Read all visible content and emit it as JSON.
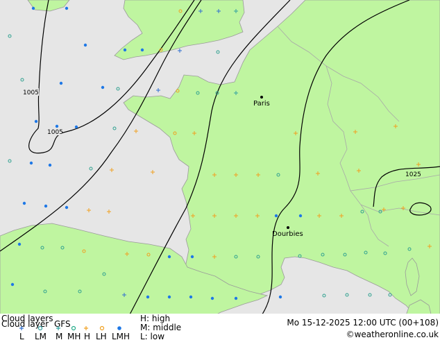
{
  "panel_title": "Cloud layers",
  "panel_subtitle": "Cloud layer",
  "model": "GFS",
  "legend_symbols": [
    {
      "key": "L",
      "symbol": "+",
      "color": "#2f6fd0"
    },
    {
      "key": "LM",
      "symbol": "o",
      "color": "#2f9fa0"
    },
    {
      "key": "M",
      "symbol": "+",
      "color": "#2fa0a0"
    },
    {
      "key": "MH",
      "symbol": "o",
      "color": "#22aa88"
    },
    {
      "key": "H",
      "symbol": "+",
      "color": "#f0a020"
    },
    {
      "key": "LH",
      "symbol": "o",
      "color": "#f0a020"
    },
    {
      "key": "LMH",
      "symbol": "dot",
      "color": "#1e78e6"
    }
  ],
  "levels": [
    "H: high",
    "M: middle",
    "L: low"
  ],
  "valid_time": "Mo 15-12-2025 12:00 UTC (00+108)",
  "credit": "©weatheronline.co.uk",
  "cities": [
    {
      "name": "Paris"
    },
    {
      "name": "Dourbies"
    }
  ],
  "isobars": [
    "1005",
    "1005",
    "1025"
  ],
  "colors": {
    "land": "#bff5a0",
    "sea": "#e6e6e6",
    "border": "#a0a0a0",
    "isobar": "#000000"
  }
}
